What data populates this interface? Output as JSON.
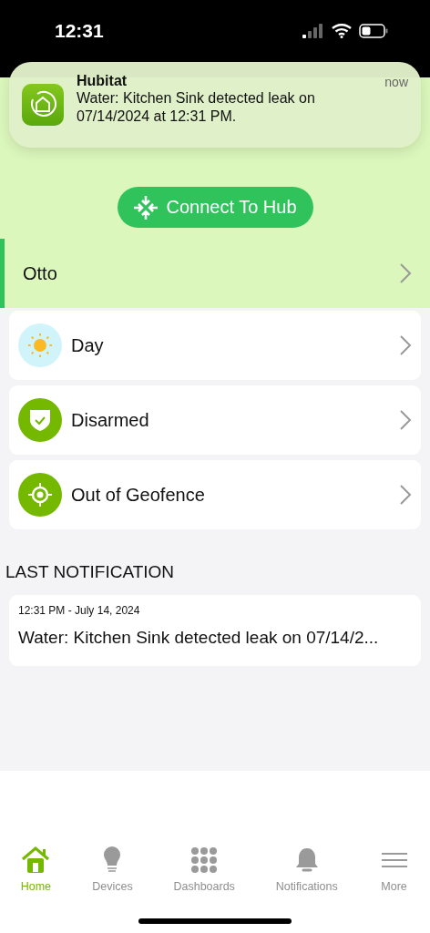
{
  "status_bar": {
    "time": "12:31"
  },
  "banner": {
    "app": "Hubitat",
    "time": "now",
    "message": "Water: Kitchen Sink detected leak on 07/14/2024 at 12:31 PM."
  },
  "connect_button": {
    "label": "Connect To Hub"
  },
  "hub": {
    "name": "Otto",
    "selected": true
  },
  "modes": [
    {
      "kind": "day",
      "label": "Day"
    },
    {
      "kind": "security",
      "label": "Disarmed"
    },
    {
      "kind": "geofence",
      "label": "Out of Geofence"
    }
  ],
  "last_notification": {
    "heading": "LAST NOTIFICATION",
    "time": "12:31 PM - July 14, 2024",
    "message": "Water: Kitchen Sink detected leak on 07/14/2..."
  },
  "tabs": [
    {
      "kind": "home",
      "label": "Home",
      "selected": true
    },
    {
      "kind": "devices",
      "label": "Devices",
      "selected": false
    },
    {
      "kind": "dashboards",
      "label": "Dashboards",
      "selected": false
    },
    {
      "kind": "notifications",
      "label": "Notifications",
      "selected": false
    },
    {
      "kind": "more",
      "label": "More",
      "selected": false
    }
  ]
}
